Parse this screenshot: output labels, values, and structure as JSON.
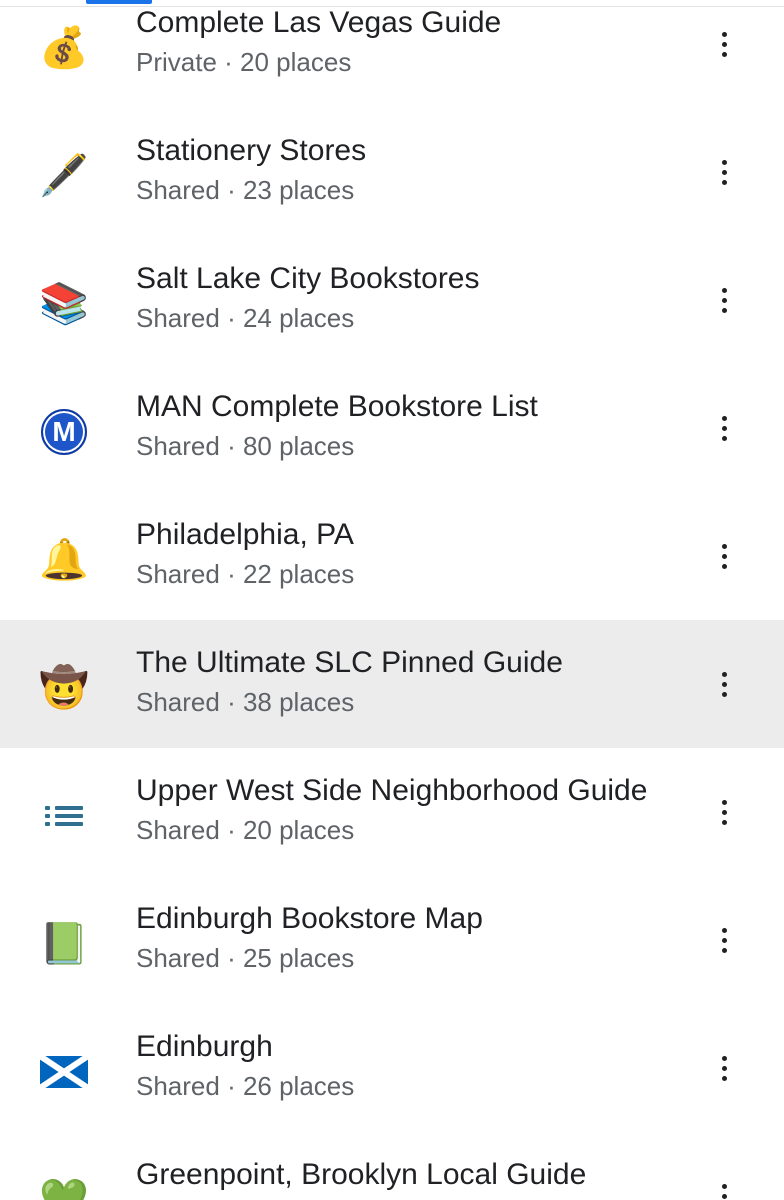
{
  "lists": [
    {
      "icon": "money-bag-icon",
      "glyph": "💰",
      "title": "Complete Las Vegas Guide",
      "subtitle": "Private · 20 places",
      "highlighted": false
    },
    {
      "icon": "fountain-pen-icon",
      "glyph": "🖋️",
      "title": "Stationery Stores",
      "subtitle": "Shared · 23 places",
      "highlighted": false
    },
    {
      "icon": "books-icon",
      "glyph": "📚",
      "title": "Salt Lake City Bookstores",
      "subtitle": "Shared · 24 places",
      "highlighted": false
    },
    {
      "icon": "metro-m-icon",
      "glyph": "M",
      "title": "MAN Complete Bookstore List",
      "subtitle": "Shared · 80 places",
      "highlighted": false
    },
    {
      "icon": "bell-icon",
      "glyph": "🔔",
      "title": "Philadelphia, PA",
      "subtitle": "Shared · 22 places",
      "highlighted": false
    },
    {
      "icon": "cowboy-face-icon",
      "glyph": "🤠",
      "title": "The Ultimate SLC Pinned Guide",
      "subtitle": "Shared · 38 places",
      "highlighted": true
    },
    {
      "icon": "list-icon",
      "glyph": "",
      "title": "Upper West Side Neighborhood Guide",
      "subtitle": "Shared · 20 places",
      "highlighted": false
    },
    {
      "icon": "green-book-icon",
      "glyph": "📗",
      "title": "Edinburgh Bookstore Map",
      "subtitle": "Shared · 25 places",
      "highlighted": false
    },
    {
      "icon": "scotland-flag-icon",
      "glyph": "🏴",
      "title": "Edinburgh",
      "subtitle": "Shared · 26 places",
      "highlighted": false
    },
    {
      "icon": "green-heart-icon",
      "glyph": "💚",
      "title": "Greenpoint, Brooklyn Local Guide",
      "subtitle": "",
      "highlighted": false
    }
  ],
  "colors": {
    "accent": "#1a73e8",
    "highlight_row": "#ececec",
    "title_text": "#202124",
    "subtitle_text": "#5f6368"
  }
}
